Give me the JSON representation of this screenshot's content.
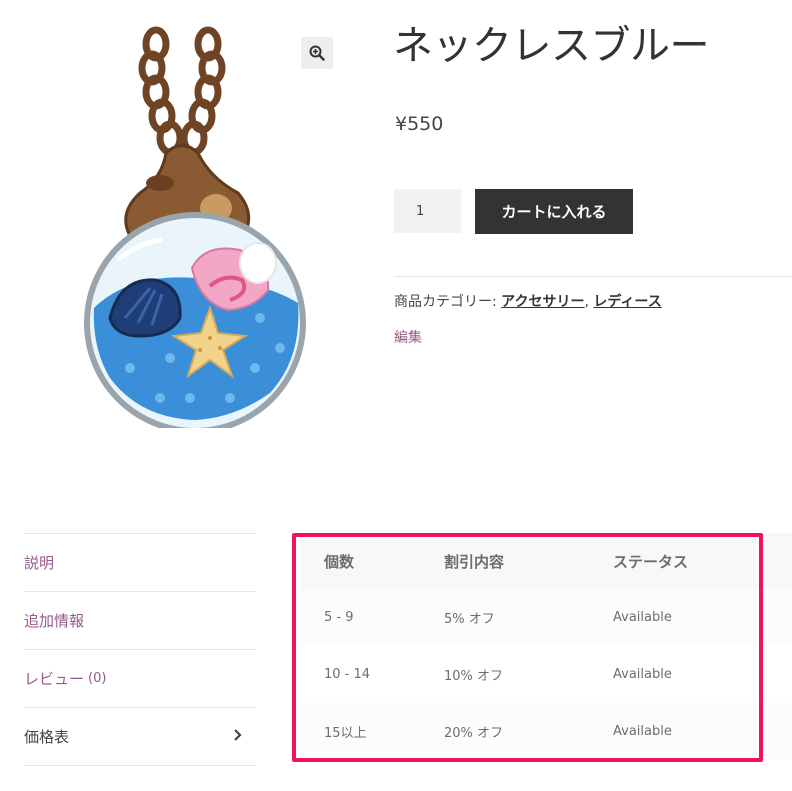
{
  "product": {
    "title": "ネックレスブルー",
    "price": "¥550",
    "quantity": "1",
    "add_to_cart_label": "カートに入れる",
    "image_icon": "bottle-necklace-illustration"
  },
  "meta": {
    "category_label": "商品カテゴリー:",
    "categories": [
      "アクセサリー",
      "レディース"
    ],
    "separator": ",",
    "edit_label": "編集"
  },
  "tabs": [
    {
      "label": "説明"
    },
    {
      "label": "追加情報"
    },
    {
      "label": "レビュー",
      "count": "(0)"
    },
    {
      "label": "価格表"
    }
  ],
  "pricing_table": {
    "headers": [
      "個数",
      "割引内容",
      "ステータス"
    ],
    "rows": [
      [
        "5 - 9",
        "5% オフ",
        "Available"
      ],
      [
        "10 - 14",
        "10% オフ",
        "Available"
      ],
      [
        "15以上",
        "20% オフ",
        "Available"
      ]
    ]
  },
  "colors": {
    "accent_purple": "#96588a",
    "button_dark": "#333333",
    "highlight_border": "#f0135f"
  }
}
